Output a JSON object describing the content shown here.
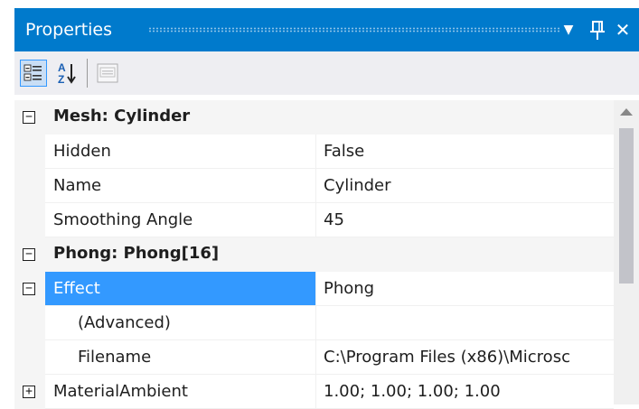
{
  "panel": {
    "title": "Properties",
    "buttons": {
      "dropdown": "▼",
      "pin": "⨅",
      "close": "✕"
    }
  },
  "toolbar": {
    "items": [
      {
        "name": "categorized-icon",
        "active": true
      },
      {
        "name": "alphabetical-icon",
        "active": false
      },
      {
        "name": "property-pages-icon",
        "active": false,
        "disabled": true
      }
    ]
  },
  "grid": {
    "rows": [
      {
        "kind": "category",
        "expander": "−",
        "label": "Mesh: Cylinder"
      },
      {
        "kind": "property",
        "name": "Hidden",
        "value": "False"
      },
      {
        "kind": "property",
        "name": "Name",
        "value": "Cylinder"
      },
      {
        "kind": "property",
        "name": "Smoothing Angle",
        "value": "45"
      },
      {
        "kind": "category",
        "expander": "−",
        "label": "Phong: Phong[16]"
      },
      {
        "kind": "property",
        "name": "Effect",
        "value": "Phong",
        "selected": true,
        "expander": "−"
      },
      {
        "kind": "property",
        "name": "(Advanced)",
        "value": "",
        "indent": 1
      },
      {
        "kind": "property",
        "name": "Filename",
        "value": "C:\\Program Files (x86)\\Microsc",
        "indent": 1
      },
      {
        "kind": "property",
        "name": "MaterialAmbient",
        "value": "1.00; 1.00; 1.00; 1.00",
        "expander": "+"
      }
    ]
  },
  "colors": {
    "titlebar": "#007acc",
    "selection": "#3399ff",
    "category_bg": "#f5f5f5",
    "toolbar_bg": "#eeeef2"
  }
}
